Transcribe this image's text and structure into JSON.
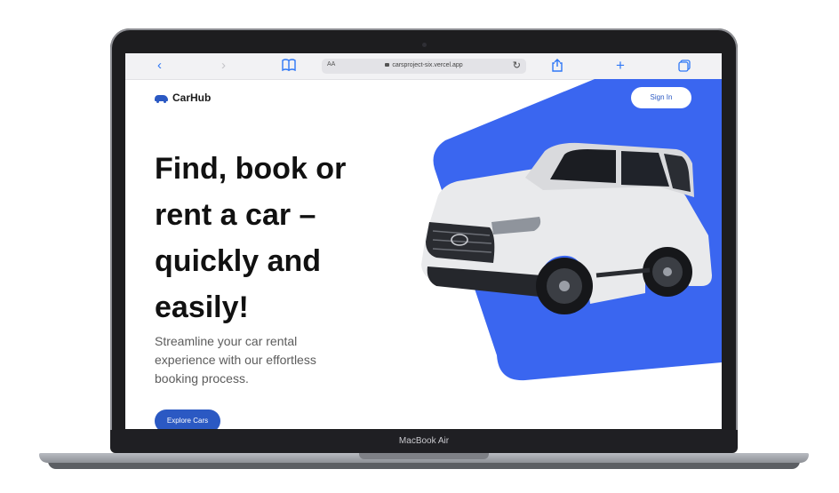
{
  "device": {
    "label": "MacBook Air"
  },
  "browser": {
    "back_icon": "chevron-left-icon",
    "forward_icon": "chevron-right-icon",
    "reader_icon": "book-icon",
    "aa_label": "AA",
    "url": "carsproject-six.vercel.app",
    "reload_icon": "reload-icon",
    "share_icon": "share-icon",
    "new_tab_icon": "plus-icon",
    "tabs_icon": "tabs-icon"
  },
  "header": {
    "logo_text": "CarHub",
    "signin_label": "Sign In"
  },
  "hero": {
    "title": "Find, book or rent a car – quickly and easily!",
    "subtitle": "Streamline your car rental experience with our effortless booking process.",
    "cta_label": "Explore Cars"
  },
  "colors": {
    "brand_blue": "#2b59c3",
    "hero_blue": "#3a66f0",
    "toolbar_accent": "#2f78f6"
  }
}
